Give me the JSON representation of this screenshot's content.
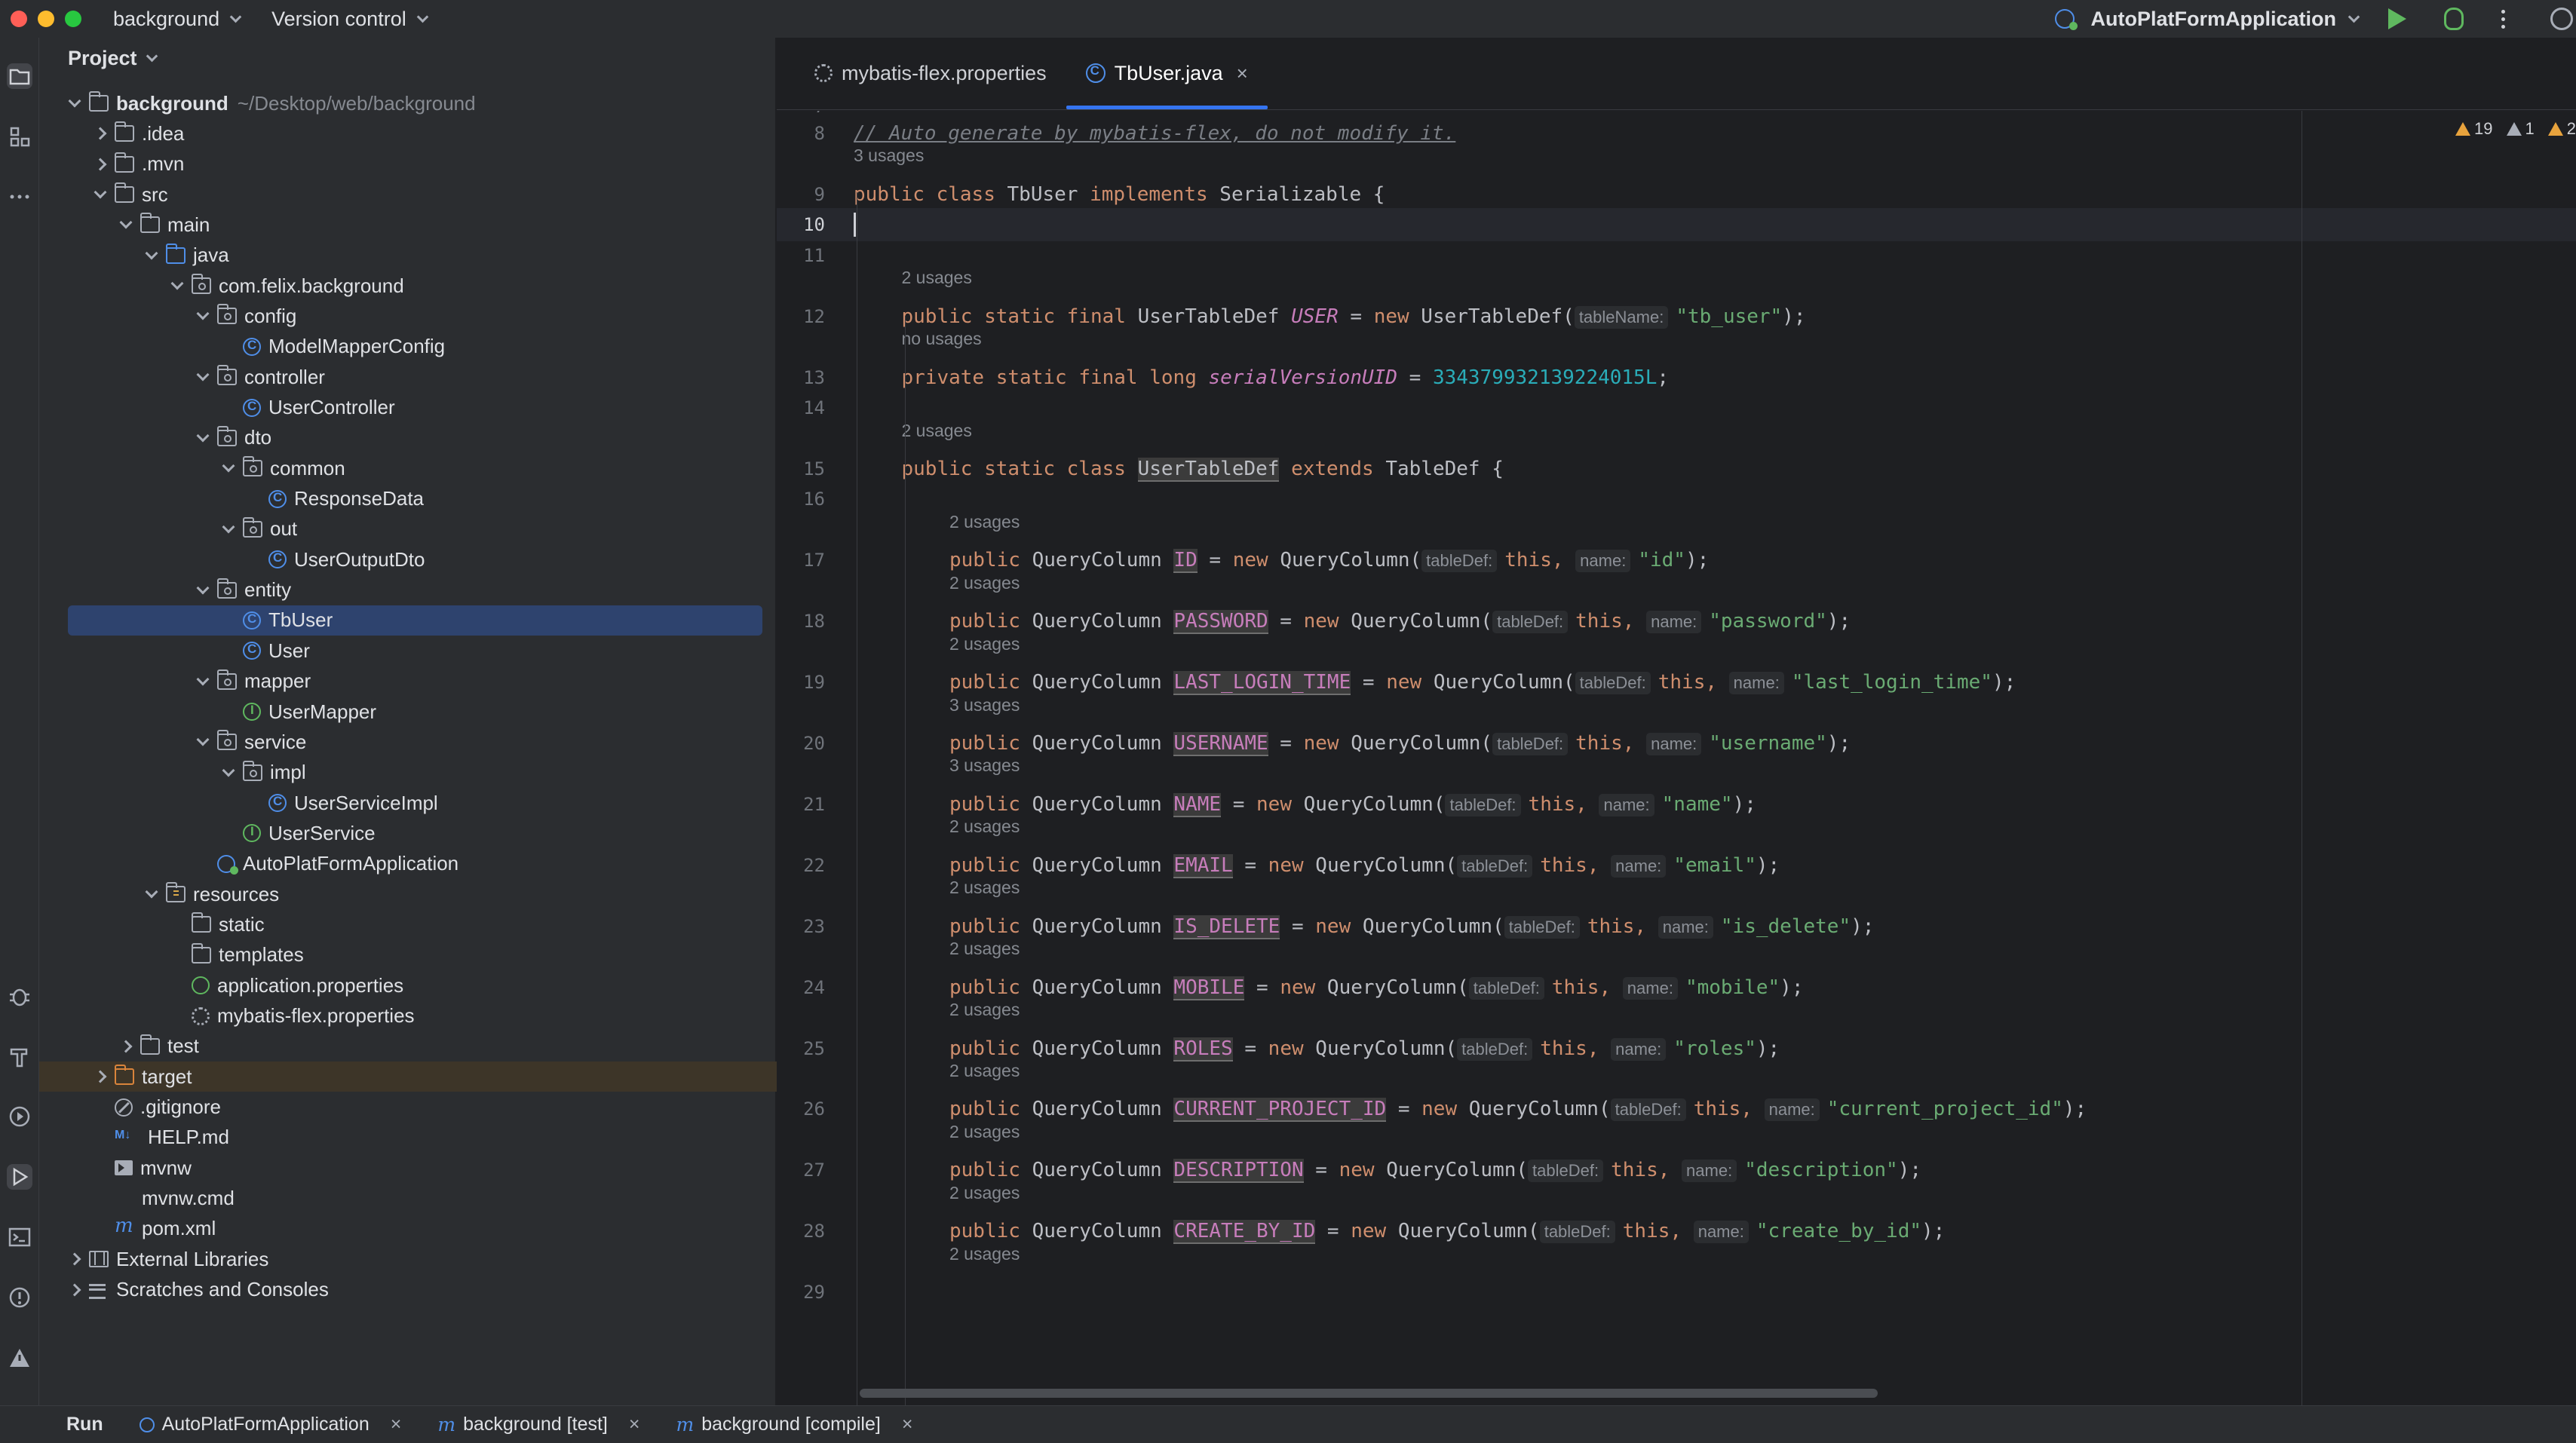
{
  "topbar": {
    "project": "background",
    "version_control": "Version control",
    "run_config": "AutoPlatFormApplication"
  },
  "project_panel": {
    "title": "Project",
    "tree": [
      {
        "label": "background",
        "hint": "~/Desktop/web/background",
        "depth": 0,
        "state": "open",
        "icon": "module-folder-icon",
        "bold": true
      },
      {
        "label": ".idea",
        "depth": 1,
        "state": "closed",
        "icon": "folder-icon"
      },
      {
        "label": ".mvn",
        "depth": 1,
        "state": "closed",
        "icon": "folder-icon"
      },
      {
        "label": "src",
        "depth": 1,
        "state": "open",
        "icon": "folder-icon"
      },
      {
        "label": "main",
        "depth": 2,
        "state": "open",
        "icon": "folder-icon"
      },
      {
        "label": "java",
        "depth": 3,
        "state": "open",
        "icon": "source-folder-icon"
      },
      {
        "label": "com.felix.background",
        "depth": 4,
        "state": "open",
        "icon": "package-icon"
      },
      {
        "label": "config",
        "depth": 5,
        "state": "open",
        "icon": "package-icon"
      },
      {
        "label": "ModelMapperConfig",
        "depth": 6,
        "state": "none",
        "icon": "class-icon"
      },
      {
        "label": "controller",
        "depth": 5,
        "state": "open",
        "icon": "package-icon"
      },
      {
        "label": "UserController",
        "depth": 6,
        "state": "none",
        "icon": "class-icon"
      },
      {
        "label": "dto",
        "depth": 5,
        "state": "open",
        "icon": "package-icon"
      },
      {
        "label": "common",
        "depth": 6,
        "state": "open",
        "icon": "package-icon"
      },
      {
        "label": "ResponseData",
        "depth": 7,
        "state": "none",
        "icon": "class-icon"
      },
      {
        "label": "out",
        "depth": 6,
        "state": "open",
        "icon": "package-icon"
      },
      {
        "label": "UserOutputDto",
        "depth": 7,
        "state": "none",
        "icon": "class-icon"
      },
      {
        "label": "entity",
        "depth": 5,
        "state": "open",
        "icon": "package-icon"
      },
      {
        "label": "TbUser",
        "depth": 6,
        "state": "none",
        "icon": "class-icon",
        "selected": true
      },
      {
        "label": "User",
        "depth": 6,
        "state": "none",
        "icon": "class-icon"
      },
      {
        "label": "mapper",
        "depth": 5,
        "state": "open",
        "icon": "package-icon"
      },
      {
        "label": "UserMapper",
        "depth": 6,
        "state": "none",
        "icon": "interface-icon"
      },
      {
        "label": "service",
        "depth": 5,
        "state": "open",
        "icon": "package-icon"
      },
      {
        "label": "impl",
        "depth": 6,
        "state": "open",
        "icon": "package-icon"
      },
      {
        "label": "UserServiceImpl",
        "depth": 7,
        "state": "none",
        "icon": "class-icon"
      },
      {
        "label": "UserService",
        "depth": 6,
        "state": "none",
        "icon": "interface-icon"
      },
      {
        "label": "AutoPlatFormApplication",
        "depth": 5,
        "state": "none",
        "icon": "spring-class-icon"
      },
      {
        "label": "resources",
        "depth": 3,
        "state": "open",
        "icon": "resources-folder-icon"
      },
      {
        "label": "static",
        "depth": 4,
        "state": "none",
        "icon": "folder-icon"
      },
      {
        "label": "templates",
        "depth": 4,
        "state": "none",
        "icon": "folder-icon"
      },
      {
        "label": "application.properties",
        "depth": 4,
        "state": "none",
        "icon": "spring-properties-icon"
      },
      {
        "label": "mybatis-flex.properties",
        "depth": 4,
        "state": "none",
        "icon": "properties-gear-icon"
      },
      {
        "label": "test",
        "depth": 2,
        "state": "closed",
        "icon": "folder-icon"
      },
      {
        "label": "target",
        "depth": 1,
        "state": "closed",
        "icon": "excluded-folder-icon",
        "highlight": true
      },
      {
        "label": ".gitignore",
        "depth": 1,
        "state": "none",
        "icon": "gitignore-icon"
      },
      {
        "label": "HELP.md",
        "depth": 1,
        "state": "none",
        "icon": "markdown-icon"
      },
      {
        "label": "mvnw",
        "depth": 1,
        "state": "none",
        "icon": "script-icon"
      },
      {
        "label": "mvnw.cmd",
        "depth": 1,
        "state": "none",
        "icon": "file-icon"
      },
      {
        "label": "pom.xml",
        "depth": 1,
        "state": "none",
        "icon": "maven-icon"
      },
      {
        "label": "External Libraries",
        "depth": 0,
        "state": "closed",
        "icon": "library-icon"
      },
      {
        "label": "Scratches and Consoles",
        "depth": 0,
        "state": "closed",
        "icon": "scratches-icon"
      }
    ]
  },
  "editor": {
    "tabs": [
      {
        "label": "mybatis-flex.properties",
        "icon": "properties-gear-icon",
        "active": false
      },
      {
        "label": "TbUser.java",
        "icon": "class-icon",
        "active": true
      }
    ],
    "inspections": {
      "warnings": "19",
      "weak_warnings": "1",
      "more": "2"
    },
    "lines": [
      {
        "n": "8",
        "kind": "comment",
        "text": "// Auto generate by mybatis-flex, do not modify it.",
        "usage": "3 usages"
      },
      {
        "n": "9",
        "kind": "class_decl",
        "usage": ""
      },
      {
        "n": "10",
        "kind": "blank",
        "current": true
      },
      {
        "n": "11",
        "kind": "blank",
        "usage": "2 usages"
      },
      {
        "n": "12",
        "kind": "user_field",
        "usage": "no usages"
      },
      {
        "n": "13",
        "kind": "serial",
        "usage": ""
      },
      {
        "n": "14",
        "kind": "blank",
        "usage": "2 usages"
      },
      {
        "n": "15",
        "kind": "inner_class",
        "usage": ""
      },
      {
        "n": "16",
        "kind": "blank",
        "usage": "2 usages"
      }
    ],
    "columns": [
      {
        "n": "17",
        "name": "ID",
        "value": "\"id\"",
        "usage_after": "2 usages"
      },
      {
        "n": "18",
        "name": "PASSWORD",
        "value": "\"password\"",
        "usage_after": "2 usages"
      },
      {
        "n": "19",
        "name": "LAST_LOGIN_TIME",
        "value": "\"last_login_time\"",
        "usage_after": "3 usages"
      },
      {
        "n": "20",
        "name": "USERNAME",
        "value": "\"username\"",
        "usage_after": "3 usages"
      },
      {
        "n": "21",
        "name": "NAME",
        "value": "\"name\"",
        "usage_after": "2 usages"
      },
      {
        "n": "22",
        "name": "EMAIL",
        "value": "\"email\"",
        "usage_after": "2 usages"
      },
      {
        "n": "23",
        "name": "IS_DELETE",
        "value": "\"is_delete\"",
        "usage_after": "2 usages"
      },
      {
        "n": "24",
        "name": "MOBILE",
        "value": "\"mobile\"",
        "usage_after": "2 usages"
      },
      {
        "n": "25",
        "name": "ROLES",
        "value": "\"roles\"",
        "usage_after": "2 usages"
      },
      {
        "n": "26",
        "name": "CURRENT_PROJECT_ID",
        "value": "\"current_project_id\"",
        "usage_after": "2 usages"
      },
      {
        "n": "27",
        "name": "DESCRIPTION",
        "value": "\"description\"",
        "usage_after": "2 usages"
      },
      {
        "n": "28",
        "name": "CREATE_BY_ID",
        "value": "\"create_by_id\"",
        "usage_after": "2 usages"
      }
    ],
    "tokens": {
      "public": "public",
      "static": "static",
      "final": "final",
      "class": "class",
      "private": "private",
      "long": "long",
      "new": "new",
      "implements": "implements",
      "extends": "extends",
      "this": "this,",
      "tb_user_class": "TbUser",
      "serializable": "Serializable {",
      "user_table_def": "UserTableDef",
      "user_const": "USER",
      "eq": "=",
      "ctor_open": "UserTableDef(",
      "hint_table_name": "tableName:",
      "tb_user_str": "\"tb_user\"",
      "close_semi": ");",
      "long_type": "long",
      "serial_name": "serialVersionUID",
      "serial_value": "3343799321392240 15L",
      "serial_value_exact": "3343799321392240 15L",
      "table_def": "TableDef {",
      "query_column": "QueryColumn",
      "query_column_open": "QueryColumn(",
      "hint_table_def": "tableDef:",
      "hint_name": "name:"
    }
  },
  "bottombar": {
    "run": "Run",
    "tabs": [
      {
        "label": "AutoPlatFormApplication",
        "icon": "run-spring-icon"
      },
      {
        "label": "background [test]",
        "icon": "maven-icon"
      },
      {
        "label": "background [compile]",
        "icon": "maven-icon"
      }
    ]
  }
}
